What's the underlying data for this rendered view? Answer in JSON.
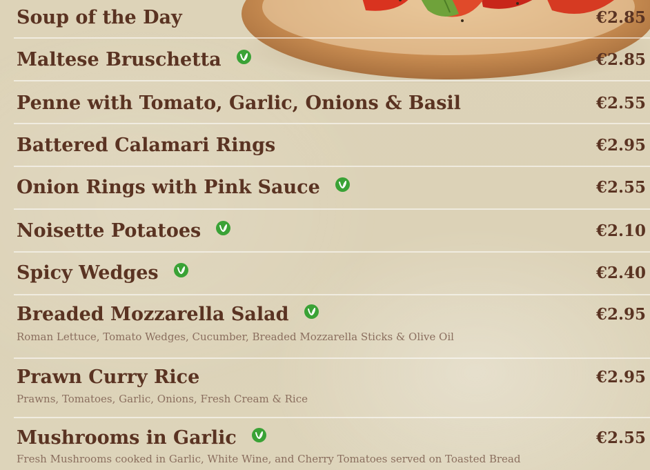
{
  "items": [
    {
      "name": "Soup of the Day",
      "price": "€2.85",
      "veg": false,
      "desc": ""
    },
    {
      "name": "Maltese Bruschetta",
      "price": "€2.85",
      "veg": true,
      "desc": ""
    },
    {
      "name": "Penne with Tomato, Garlic, Onions & Basil",
      "price": "€2.55",
      "veg": false,
      "desc": ""
    },
    {
      "name": "Battered Calamari Rings",
      "price": "€2.95",
      "veg": false,
      "desc": ""
    },
    {
      "name": "Onion Rings with Pink Sauce",
      "price": "€2.55",
      "veg": true,
      "desc": ""
    },
    {
      "name": "Noisette Potatoes",
      "price": "€2.10",
      "veg": true,
      "desc": ""
    },
    {
      "name": "Spicy Wedges",
      "price": "€2.40",
      "veg": true,
      "desc": ""
    },
    {
      "name": "Breaded Mozzarella Salad",
      "price": "€2.95",
      "veg": true,
      "desc": "Roman Lettuce, Tomato Wedges, Cucumber, Breaded Mozzarella Sticks & Olive Oil"
    },
    {
      "name": "Prawn Curry Rice",
      "price": "€2.95",
      "veg": false,
      "desc": "Prawns, Tomatoes, Garlic, Onions, Fresh Cream & Rice"
    },
    {
      "name": "Mushrooms in Garlic",
      "price": "€2.55",
      "veg": true,
      "desc": "Fresh Mushrooms cooked in Garlic, White Wine, and Cherry Tomatoes served on Toasted Bread"
    }
  ],
  "icons": {
    "vegetarian": "vegetarian-leaf-icon"
  },
  "colors": {
    "text": "#5a3322",
    "description": "#8a6e5e",
    "veg_badge": "#3aa236",
    "background": "#ddd3b8"
  }
}
